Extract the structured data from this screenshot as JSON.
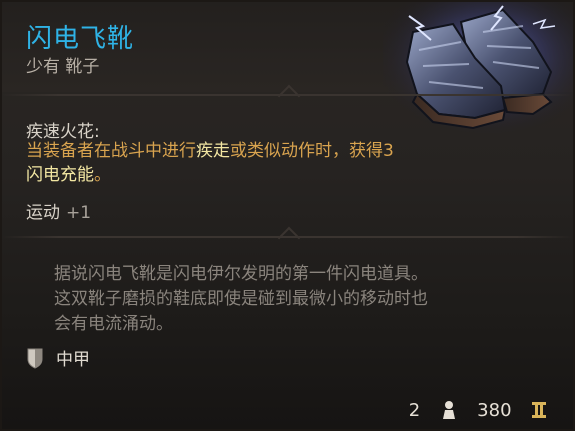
{
  "item": {
    "name": "闪电飞靴",
    "rarity_type": "少有 靴子"
  },
  "passive": {
    "name": "疾速火花:",
    "desc_1": "当装备者在战斗中进行",
    "desc_hl1": "疾走",
    "desc_2": "或类似动作时，获得3",
    "desc_hl2": "闪电充能",
    "desc_3": "。"
  },
  "stat": {
    "name": "运动",
    "value": "+1"
  },
  "flavor": {
    "line1": "据说闪电飞靴是闪电伊尔发明的第一件闪电道具。",
    "line2": "这双靴子磨损的鞋底即使是碰到最微小的移动时也",
    "line3": "会有电流涌动。"
  },
  "armor": {
    "label": "中甲",
    "icon": "shield-icon"
  },
  "footer": {
    "weight": "2",
    "weight_icon": "weight-icon",
    "value": "380",
    "value_icon": "coin-icon"
  },
  "colors": {
    "item_name": "#2fb3e6",
    "passive_desc": "#d9a44f",
    "highlight": "#f2e6a2",
    "flavor": "#8a847d"
  }
}
